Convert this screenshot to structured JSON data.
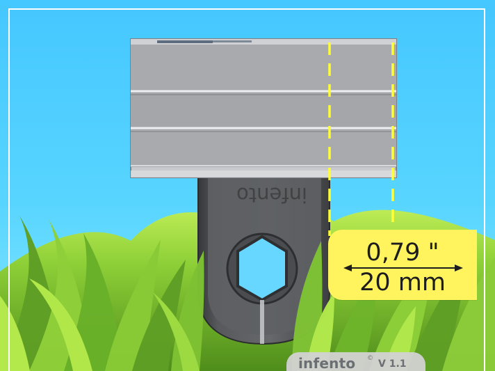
{
  "measurement": {
    "inches": "0,79 \"",
    "millimeters": "20 mm"
  },
  "brand": {
    "name": "infento",
    "registered": "©",
    "version": "V 1.1"
  },
  "part": {
    "embossed_label": "infento"
  },
  "colors": {
    "sky": "#53cfff",
    "sky_bottom": "#84e6ff",
    "grass_dark": "#4f8e1b",
    "grass_light": "#b8ef4e",
    "badge": "#fff35e",
    "guide_line": "#ffff33",
    "aluminum": "#a9aaae",
    "plastic": "#595b5d",
    "brand_text": "#6b6f73"
  },
  "icons": {
    "arrow": "double-arrow-icon",
    "hex_hole": "hexagon-icon"
  }
}
